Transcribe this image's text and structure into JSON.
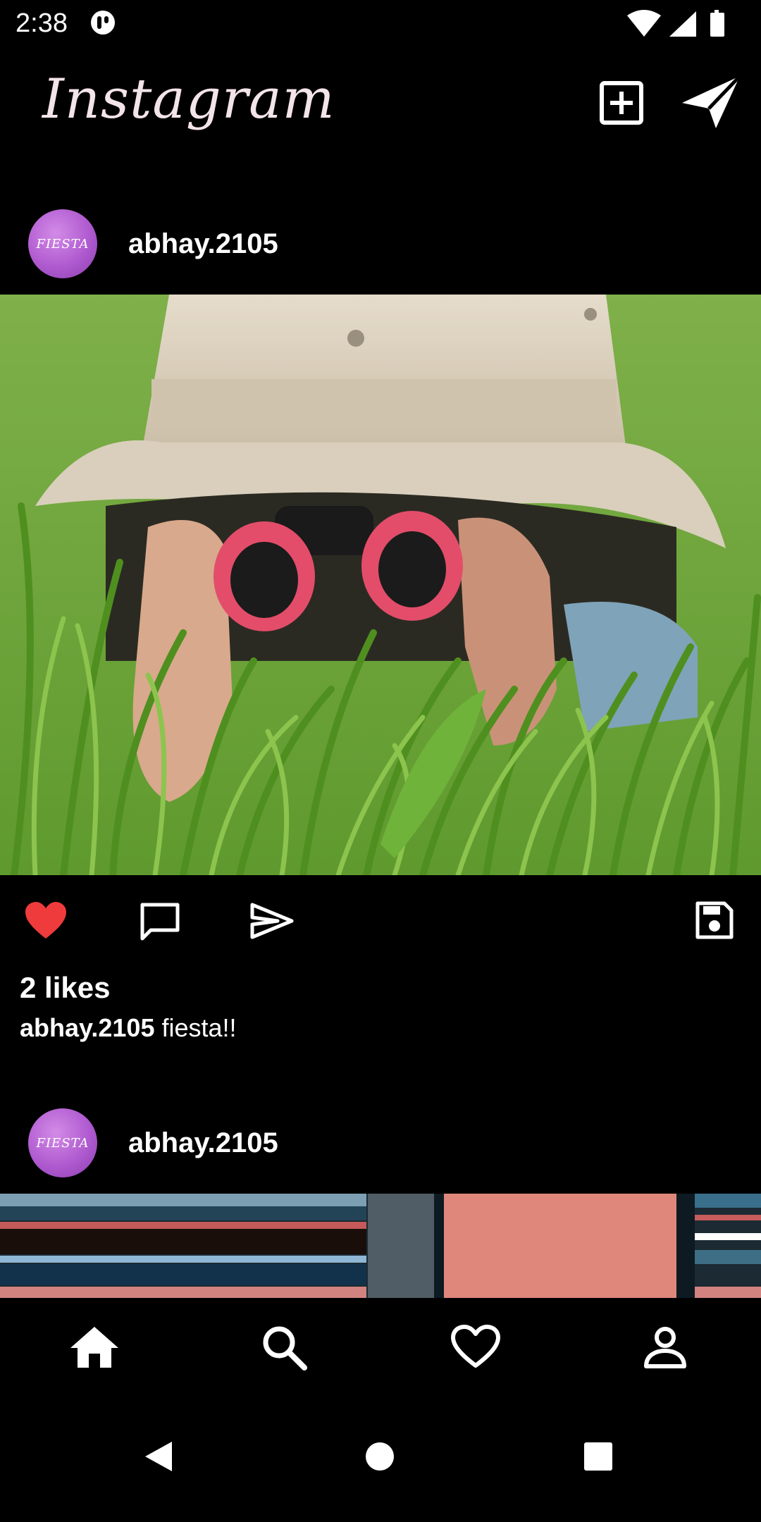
{
  "status_bar": {
    "time": "2:38"
  },
  "header": {
    "logo_text": "Instagram",
    "new_post_icon": "plus-square-icon",
    "direct_icon": "paper-plane-icon"
  },
  "posts": [
    {
      "username": "abhay.2105",
      "avatar_text": "FIESTA",
      "likes": "2 likes",
      "caption_user": "abhay.2105",
      "caption_text": "fiesta!!"
    },
    {
      "username": "abhay.2105",
      "avatar_text": "FIESTA"
    }
  ],
  "post_actions": {
    "like_icon": "heart-filled-icon",
    "comment_icon": "comment-icon",
    "share_icon": "send-icon",
    "save_icon": "save-icon"
  },
  "bottom_nav": {
    "items": [
      "home-icon",
      "search-icon",
      "heart-icon",
      "profile-icon"
    ]
  },
  "colors": {
    "background": "#000000",
    "like_red": "#ef3b3b",
    "avatar_purple": "#b05ad0"
  }
}
